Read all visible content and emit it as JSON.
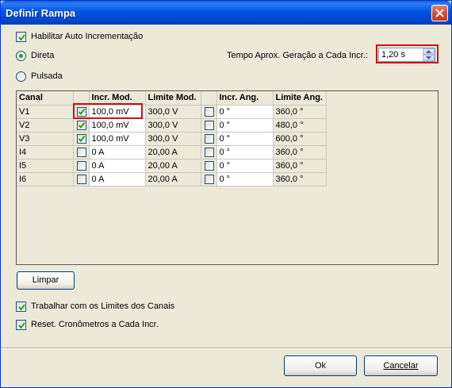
{
  "window": {
    "title": "Definir Rampa"
  },
  "options": {
    "auto_increment_label": "Habilitar Auto Incrementação",
    "direct_label": "Direta",
    "pulsed_label": "Pulsada",
    "time_label": "Tempo Aprox. Geração a Cada Incr.:",
    "time_value": "1,20 s"
  },
  "grid": {
    "headers": [
      "Canal",
      "",
      "Incr. Mod.",
      "Limite Mod.",
      "",
      "Incr. Ang.",
      "Limite Ang."
    ],
    "rows": [
      {
        "canal": "V1",
        "mod_checked": true,
        "incr_mod": "100,0 mV",
        "lim_mod": "300,0 V",
        "ang_checked": false,
        "incr_ang": "0 °",
        "lim_ang": "360,0 °"
      },
      {
        "canal": "V2",
        "mod_checked": true,
        "incr_mod": "100,0 mV",
        "lim_mod": "300,0 V",
        "ang_checked": false,
        "incr_ang": "0 °",
        "lim_ang": "480,0 °"
      },
      {
        "canal": "V3",
        "mod_checked": true,
        "incr_mod": "100,0 mV",
        "lim_mod": "300,0 V",
        "ang_checked": false,
        "incr_ang": "0 °",
        "lim_ang": "600,0 °"
      },
      {
        "canal": "I4",
        "mod_checked": false,
        "incr_mod": "0 A",
        "lim_mod": "20,00 A",
        "ang_checked": false,
        "incr_ang": "0 °",
        "lim_ang": "360,0 °"
      },
      {
        "canal": "I5",
        "mod_checked": false,
        "incr_mod": "0 A",
        "lim_mod": "20,00 A",
        "ang_checked": false,
        "incr_ang": "0 °",
        "lim_ang": "360,0 °"
      },
      {
        "canal": "I6",
        "mod_checked": false,
        "incr_mod": "0 A",
        "lim_mod": "20,00 A",
        "ang_checked": false,
        "incr_ang": "0 °",
        "lim_ang": "360,0 °"
      }
    ]
  },
  "buttons": {
    "clear_label": "Limpar",
    "ok_label": "Ok",
    "cancel_label": "Cancelar"
  },
  "bottom_options": {
    "channel_limits_label": "Trabalhar com os Limites dos Canais",
    "reset_timers_label": "Reset. Cronômetros a Cada Incr."
  },
  "state": {
    "auto_increment_checked": true,
    "direct_selected": true,
    "channel_limits_checked": true,
    "reset_timers_checked": true
  },
  "colors": {
    "title_bar": "#0054e3",
    "highlight": "#d01010",
    "check": "#21a121"
  }
}
